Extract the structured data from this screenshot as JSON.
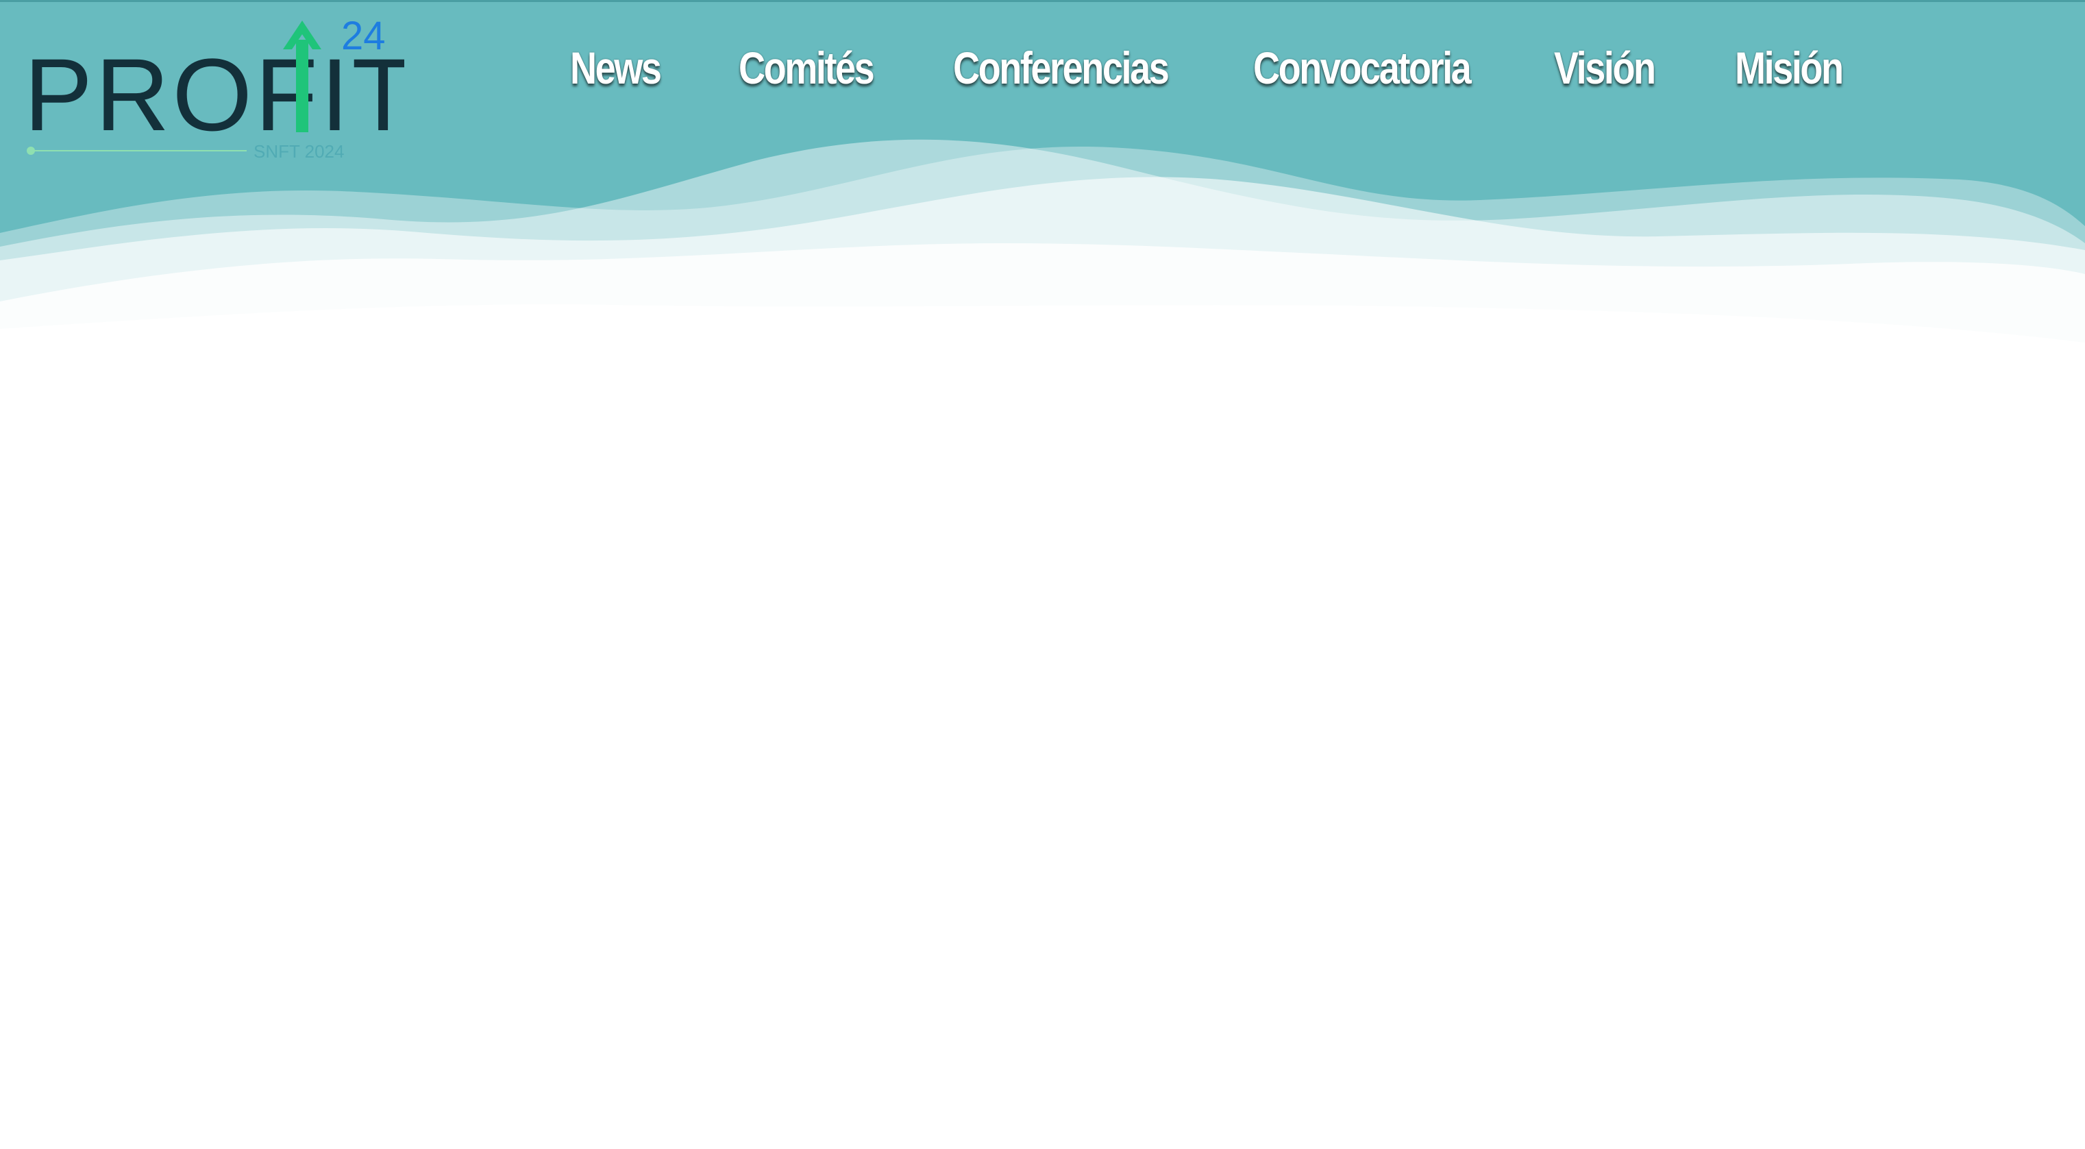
{
  "colors": {
    "header_teal": "#68bbbf",
    "logo_dark": "#13303a",
    "logo_green": "#1fc47a",
    "logo_blue": "#1e7de0",
    "nav_text": "#ffffff"
  },
  "logo": {
    "wordmark": "PROFIT",
    "superscript": "24",
    "tagline": "SNFT 2024",
    "icon": "up-arrow-icon"
  },
  "nav": {
    "items": [
      {
        "label": "News"
      },
      {
        "label": "Comités"
      },
      {
        "label": "Conferencias"
      },
      {
        "label": "Convocatoria"
      },
      {
        "label": "Visión"
      },
      {
        "label": "Misión"
      }
    ]
  }
}
